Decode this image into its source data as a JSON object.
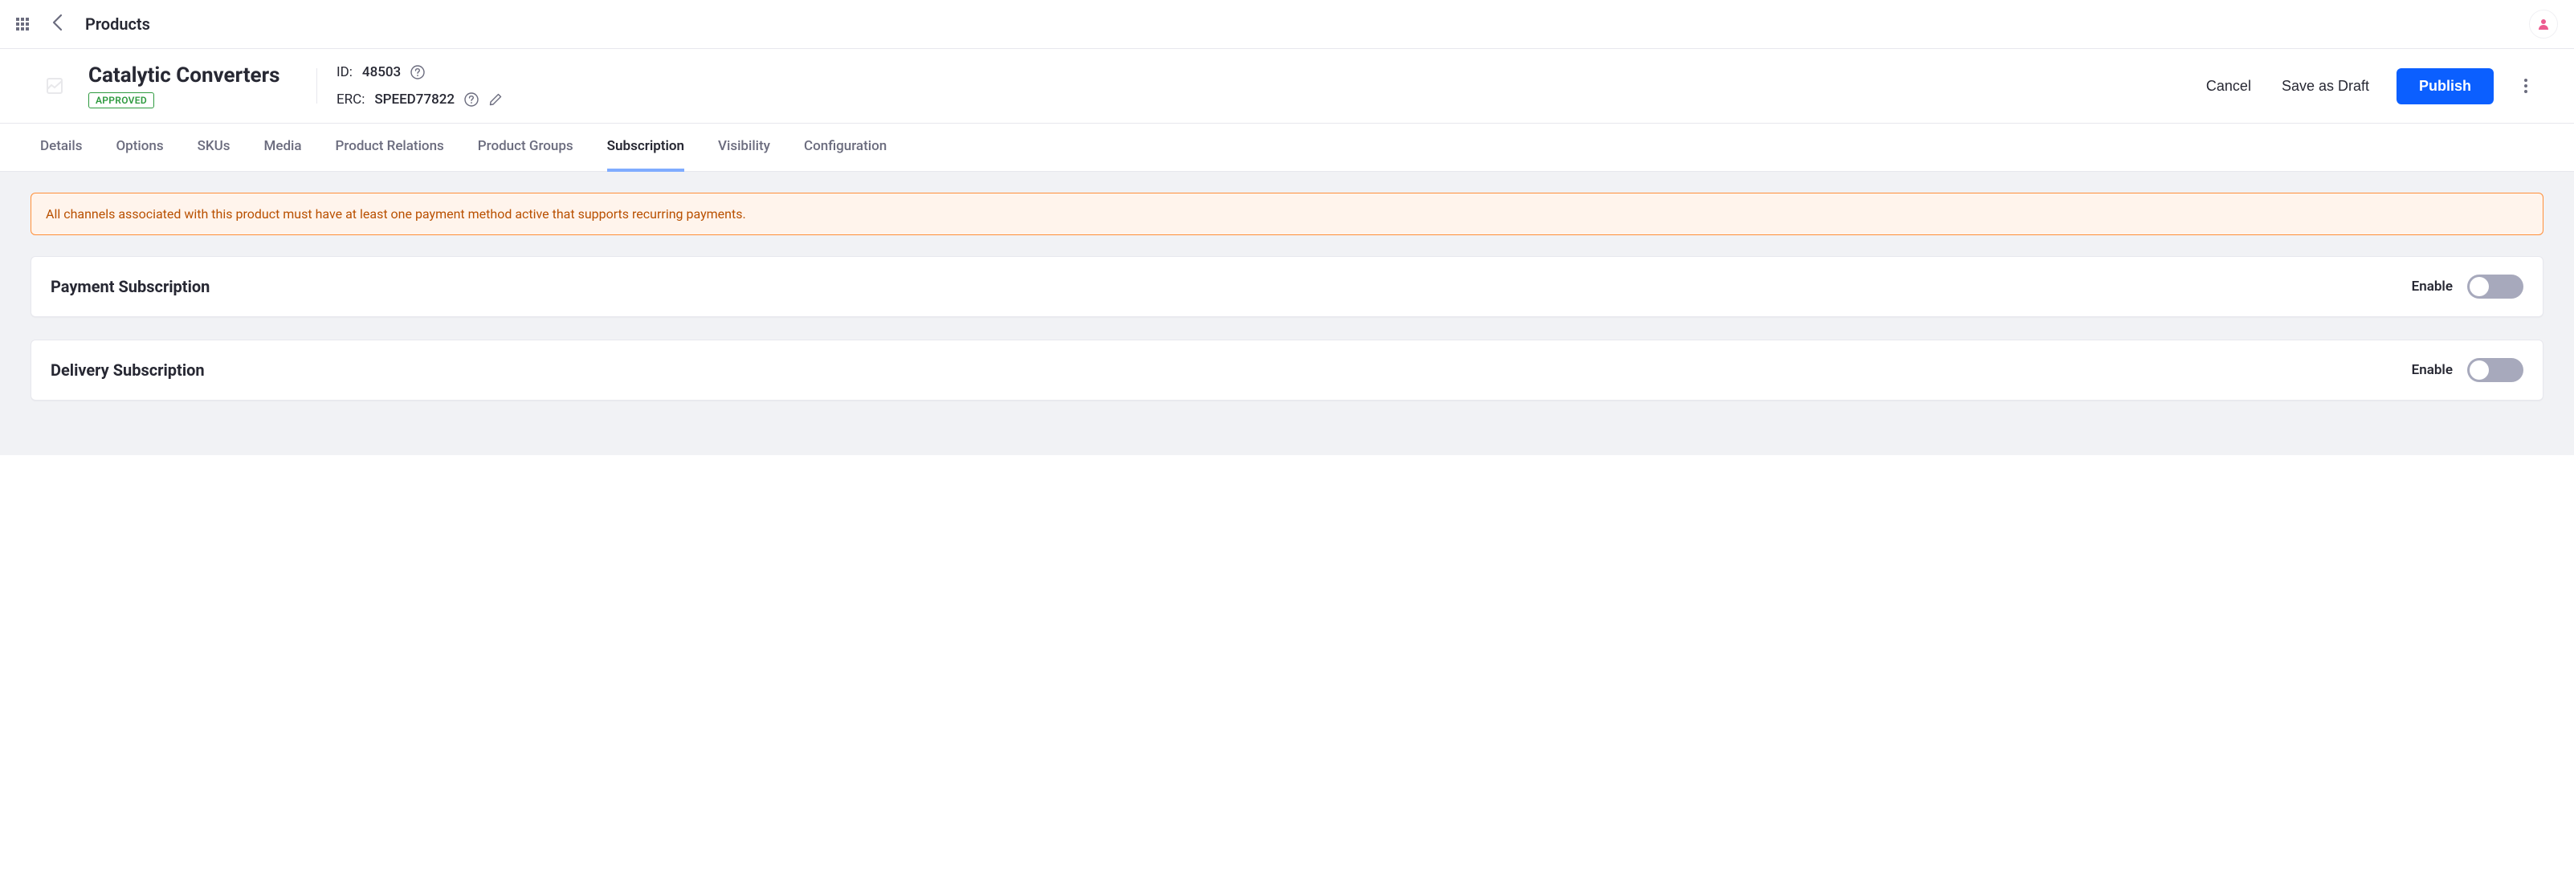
{
  "top": {
    "breadcrumb": "Products"
  },
  "product": {
    "title": "Catalytic Converters",
    "status": "APPROVED",
    "id_label": "ID:",
    "id_value": "48503",
    "erc_label": "ERC:",
    "erc_value": "SPEED77822"
  },
  "actions": {
    "cancel": "Cancel",
    "save_draft": "Save as Draft",
    "publish": "Publish"
  },
  "tabs": {
    "details": "Details",
    "options": "Options",
    "skus": "SKUs",
    "media": "Media",
    "relations": "Product Relations",
    "groups": "Product Groups",
    "subscription": "Subscription",
    "visibility": "Visibility",
    "configuration": "Configuration"
  },
  "alert": {
    "text": "All channels associated with this product must have at least one payment method active that supports recurring payments."
  },
  "panels": {
    "payment": {
      "title": "Payment Subscription",
      "enable": "Enable"
    },
    "delivery": {
      "title": "Delivery Subscription",
      "enable": "Enable"
    }
  }
}
